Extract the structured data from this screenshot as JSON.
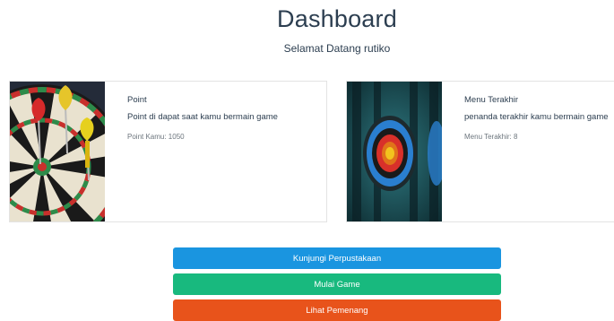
{
  "header": {
    "title": "Dashboard",
    "subtitle": "Selamat Datang rutiko"
  },
  "cards": [
    {
      "image": "darts-board-icon",
      "title": "Point",
      "text": "Point di dapat saat kamu bermain game",
      "stat": "Point Kamu: 1050"
    },
    {
      "image": "archery-target-icon",
      "title": "Menu Terakhir",
      "text": "penanda terakhir kamu bermain game",
      "stat": "Menu Terakhir: 8"
    }
  ],
  "buttons": [
    {
      "label": "Kunjungi Perpustakaan",
      "color": "#1a95e0"
    },
    {
      "label": "Mulai Game",
      "color": "#18b97e"
    },
    {
      "label": "Lihat Pemenang",
      "color": "#e8531b"
    }
  ]
}
